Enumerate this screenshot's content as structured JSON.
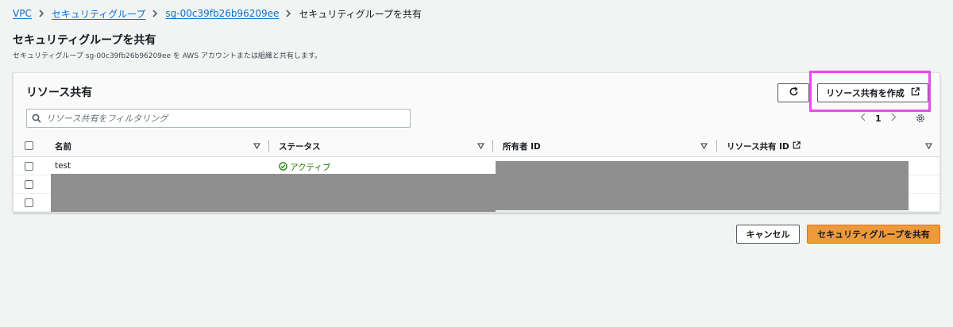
{
  "breadcrumb": {
    "items": [
      "VPC",
      "セキュリティグループ",
      "sg-00c39fb26b96209ee"
    ],
    "current": "セキュリティグループを共有"
  },
  "page": {
    "title": "セキュリティグループを共有",
    "description": "セキュリティグループ sg-00c39fb26b96209ee を AWS アカウントまたは組織と共有します。"
  },
  "panel": {
    "title": "リソース共有",
    "create_button": "リソース共有を作成",
    "filter_placeholder": "リソース共有をフィルタリング",
    "page_number": "1"
  },
  "table": {
    "columns": [
      "名前",
      "ステータス",
      "所有者 ID",
      "リソース共有 ID"
    ],
    "rows": [
      {
        "name": "test",
        "status": "アクティブ"
      },
      {
        "name": "",
        "status": ""
      },
      {
        "name": "",
        "status": ""
      }
    ]
  },
  "footer": {
    "cancel": "キャンセル",
    "submit": "セキュリティグループを共有"
  },
  "colors": {
    "link": "#0972d3",
    "status_active": "#1d8102",
    "primary": "#ec9a3b",
    "highlight": "#ec49ec",
    "redaction": "#8f8f8f"
  }
}
